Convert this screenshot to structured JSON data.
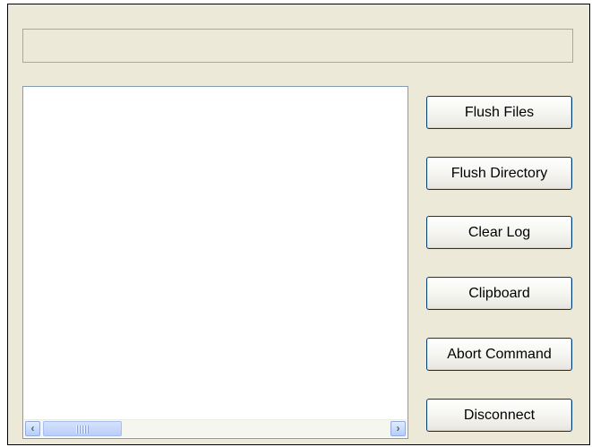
{
  "status": {
    "text": ""
  },
  "log": {
    "lines": []
  },
  "buttons": {
    "flush_files": "Flush Files",
    "flush_directory": "Flush Directory",
    "clear_log": "Clear Log",
    "clipboard": "Clipboard",
    "abort_command": "Abort Command",
    "disconnect": "Disconnect"
  },
  "scrollbar": {
    "left_arrow_icon": "chevron-left-icon",
    "right_arrow_icon": "chevron-right-icon",
    "grip_icon": "scroll-grip-icon"
  },
  "colors": {
    "dialog_bg": "#ECE9D8",
    "button_border": "#003C74",
    "scroll_accent": "#B7CDF8"
  }
}
